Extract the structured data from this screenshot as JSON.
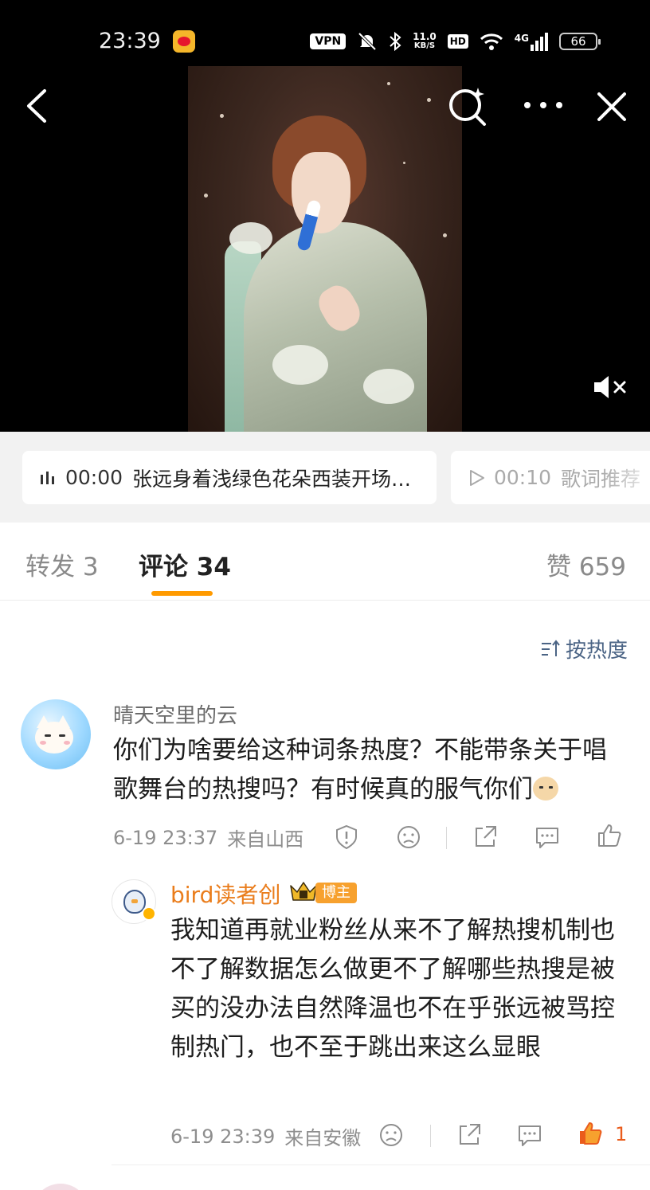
{
  "status_bar": {
    "time": "23:39",
    "vpn": "VPN",
    "net_speed_value": "11.0",
    "net_speed_unit": "KB/S",
    "hd": "HD",
    "network": "4G",
    "battery": "66"
  },
  "chapters": [
    {
      "time": "00:00",
      "title": "张远身着浅绿色花朵西装开场…",
      "state": "playing"
    },
    {
      "time": "00:10",
      "title": "歌词推荐",
      "state": "next"
    }
  ],
  "tabs": {
    "repost": "转发 3",
    "comments": "评论 34",
    "likes": "赞 659"
  },
  "sort": {
    "label": "按热度"
  },
  "comments": [
    {
      "author": "晴天空里的云",
      "text": "你们为啥要给这种词条热度？不能带条关于唱歌舞台的热搜吗？有时候真的服气你们",
      "date": "6-19 23:37",
      "location": "来自山西",
      "replies": [
        {
          "author": "bird读者创",
          "badge": "博主",
          "text": "我知道再就业粉丝从来不了解热搜机制也不了解数据怎么做更不了解哪些热搜是被买的没办法自然降温也不在乎张远被骂控制热门，也不至于跳出来这么显眼",
          "date": "6-19 23:39",
          "location": "来自安徽",
          "likes": "1"
        }
      ]
    }
  ],
  "colors": {
    "accent_orange": "#ff9a00",
    "link_blue": "#4b6485",
    "blogger_name": "#ea7d1c",
    "liked": "#ea5c1c"
  }
}
